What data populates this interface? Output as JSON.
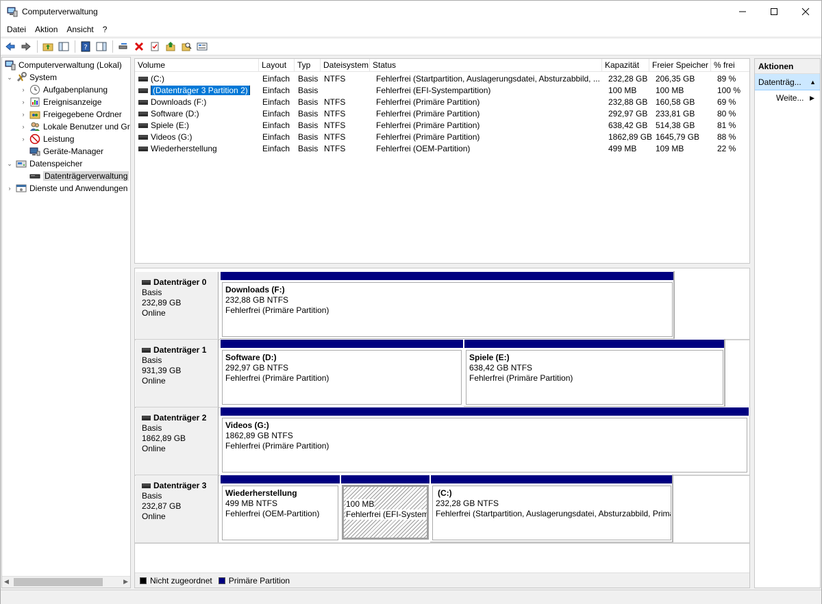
{
  "window": {
    "title": "Computerverwaltung",
    "min_glyph": "—",
    "max_glyph": "☐",
    "close_glyph": "✕"
  },
  "menu": [
    "Datei",
    "Aktion",
    "Ansicht",
    "?"
  ],
  "tree": {
    "root": "Computerverwaltung (Lokal)",
    "system": "System",
    "aufgaben": "Aufgabenplanung",
    "ereignis": "Ereignisanzeige",
    "ordner": "Freigegebene Ordner",
    "benutzer": "Lokale Benutzer und Gru",
    "leistung": "Leistung",
    "geraete": "Geräte-Manager",
    "speicher": "Datenspeicher",
    "datentraeger": "Datenträgerverwaltung",
    "dienste": "Dienste und Anwendungen"
  },
  "columns": [
    "Volume",
    "Layout",
    "Typ",
    "Dateisystem",
    "Status",
    "Kapazität",
    "Freier Speicher",
    "% frei"
  ],
  "volumes": [
    {
      "name": "(C:)",
      "layout": "Einfach",
      "typ": "Basis",
      "fs": "NTFS",
      "status": "Fehlerfrei (Startpartition, Auslagerungsdatei, Absturzabbild, ...",
      "cap": "232,28 GB",
      "free": "206,35 GB",
      "pct": "89 %"
    },
    {
      "name": "(Datenträger 3 Partition 2)",
      "layout": "Einfach",
      "typ": "Basis",
      "fs": "",
      "status": "Fehlerfrei (EFI-Systempartition)",
      "cap": "100 MB",
      "free": "100 MB",
      "pct": "100 %"
    },
    {
      "name": "Downloads (F:)",
      "layout": "Einfach",
      "typ": "Basis",
      "fs": "NTFS",
      "status": "Fehlerfrei (Primäre Partition)",
      "cap": "232,88 GB",
      "free": "160,58 GB",
      "pct": "69 %"
    },
    {
      "name": "Software (D:)",
      "layout": "Einfach",
      "typ": "Basis",
      "fs": "NTFS",
      "status": "Fehlerfrei (Primäre Partition)",
      "cap": "292,97 GB",
      "free": "233,81 GB",
      "pct": "80 %"
    },
    {
      "name": "Spiele (E:)",
      "layout": "Einfach",
      "typ": "Basis",
      "fs": "NTFS",
      "status": "Fehlerfrei (Primäre Partition)",
      "cap": "638,42 GB",
      "free": "514,38 GB",
      "pct": "81 %"
    },
    {
      "name": "Videos (G:)",
      "layout": "Einfach",
      "typ": "Basis",
      "fs": "NTFS",
      "status": "Fehlerfrei (Primäre Partition)",
      "cap": "1862,89 GB",
      "free": "1645,79 GB",
      "pct": "88 %"
    },
    {
      "name": "Wiederherstellung",
      "layout": "Einfach",
      "typ": "Basis",
      "fs": "NTFS",
      "status": "Fehlerfrei (OEM-Partition)",
      "cap": "499 MB",
      "free": "109 MB",
      "pct": "22 %"
    }
  ],
  "disks": [
    {
      "name": "Datenträger 0",
      "type": "Basis",
      "size": "232,89 GB",
      "state": "Online",
      "parts": [
        {
          "title": "Downloads  (F:)",
          "size": "232,88 GB NTFS",
          "status": "Fehlerfrei (Primäre Partition)"
        }
      ]
    },
    {
      "name": "Datenträger 1",
      "type": "Basis",
      "size": "931,39 GB",
      "state": "Online",
      "parts": [
        {
          "title": "Software  (D:)",
          "size": "292,97 GB NTFS",
          "status": "Fehlerfrei (Primäre Partition)"
        },
        {
          "title": "Spiele  (E:)",
          "size": "638,42 GB NTFS",
          "status": "Fehlerfrei (Primäre Partition)"
        }
      ]
    },
    {
      "name": "Datenträger 2",
      "type": "Basis",
      "size": "1862,89 GB",
      "state": "Online",
      "parts": [
        {
          "title": "Videos  (G:)",
          "size": "1862,89 GB NTFS",
          "status": "Fehlerfrei (Primäre Partition)"
        }
      ]
    },
    {
      "name": "Datenträger 3",
      "type": "Basis",
      "size": "232,87 GB",
      "state": "Online",
      "parts": [
        {
          "title": "Wiederherstellung",
          "size": "499 MB NTFS",
          "status": "Fehlerfrei (OEM-Partition)"
        },
        {
          "title": "",
          "size": "100 MB",
          "status": "Fehlerfrei (EFI-Systempartition)"
        },
        {
          "title": "(C:)",
          "size": "232,28 GB NTFS",
          "status": "Fehlerfrei (Startpartition, Auslagerungsdatei, Absturzabbild, Primäre Partition)"
        }
      ]
    }
  ],
  "legend": {
    "unallocated": "Nicht zugeordnet",
    "primary": "Primäre Partition",
    "unallocated_color": "#000000",
    "primary_color": "#000080"
  },
  "actions": {
    "header": "Aktionen",
    "section": "Datenträg...",
    "more": "Weite..."
  },
  "colors": {
    "selection": "#0078d7",
    "partition_bar": "#000080",
    "action_highlight": "#cce8ff"
  }
}
